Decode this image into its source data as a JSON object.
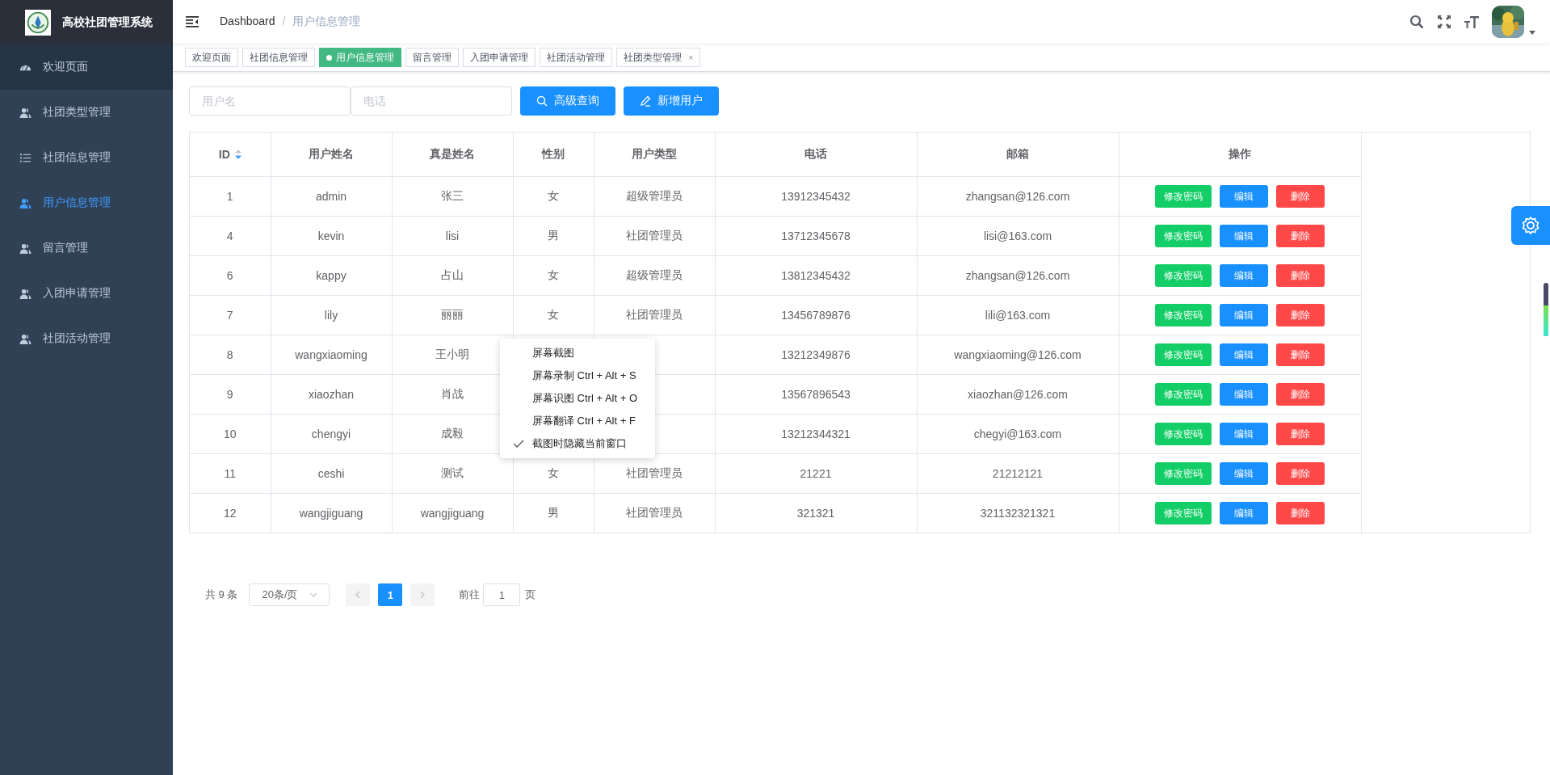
{
  "sidebar": {
    "title": "高校社团管理系统",
    "items": [
      {
        "label": "欢迎页面",
        "kind": "dashboard",
        "selected": false,
        "hovered": true
      },
      {
        "label": "社团类型管理",
        "kind": "user",
        "selected": false,
        "hovered": false
      },
      {
        "label": "社团信息管理",
        "kind": "list",
        "selected": false,
        "hovered": false
      },
      {
        "label": "用户信息管理",
        "kind": "user",
        "selected": true,
        "hovered": false
      },
      {
        "label": "留言管理",
        "kind": "user",
        "selected": false,
        "hovered": false
      },
      {
        "label": "入团申请管理",
        "kind": "user",
        "selected": false,
        "hovered": false
      },
      {
        "label": "社团活动管理",
        "kind": "user",
        "selected": false,
        "hovered": false
      }
    ]
  },
  "breadcrumb": [
    "Dashboard",
    "/",
    "用户信息管理"
  ],
  "tags": [
    {
      "label": "欢迎页面",
      "selected": false,
      "closable": false
    },
    {
      "label": "社团信息管理",
      "selected": false,
      "closable": false
    },
    {
      "label": "用户信息管理",
      "selected": true,
      "closable": false
    },
    {
      "label": "留言管理",
      "selected": false,
      "closable": false
    },
    {
      "label": "入团申请管理",
      "selected": false,
      "closable": false
    },
    {
      "label": "社团活动管理",
      "selected": false,
      "closable": false
    },
    {
      "label": "社团类型管理",
      "selected": false,
      "closable": true,
      "close": "×"
    }
  ],
  "search": {
    "username_placeholder": "用户名",
    "phone_placeholder": "电话",
    "query_button": "高级查询",
    "add_button": "新增用户"
  },
  "table": {
    "columns": [
      "ID",
      "用户姓名",
      "真是姓名",
      "性别",
      "用户类型",
      "电话",
      "邮箱",
      "操作"
    ],
    "rows": [
      {
        "id": "1",
        "username": "admin",
        "realname": "张三",
        "gender": "女",
        "type": "超级管理员",
        "phone": "13912345432",
        "email": "zhangsan@126.com"
      },
      {
        "id": "4",
        "username": "kevin",
        "realname": "lisi",
        "gender": "男",
        "type": "社团管理员",
        "phone": "13712345678",
        "email": "lisi@163.com"
      },
      {
        "id": "6",
        "username": "kappy",
        "realname": "占山",
        "gender": "女",
        "type": "超级管理员",
        "phone": "13812345432",
        "email": "zhangsan@126.com"
      },
      {
        "id": "7",
        "username": "lily",
        "realname": "丽丽",
        "gender": "女",
        "type": "社团管理员",
        "phone": "13456789876",
        "email": "lili@163.com"
      },
      {
        "id": "8",
        "username": "wangxiaoming",
        "realname": "王小明",
        "phone": "13212349876",
        "email": "wangxiaoming@126.com"
      },
      {
        "id": "9",
        "username": "xiaozhan",
        "realname": "肖战",
        "phone": "13567896543",
        "email": "xiaozhan@126.com"
      },
      {
        "id": "10",
        "username": "chengyi",
        "realname": "成毅",
        "phone": "13212344321",
        "email": "chegyi@163.com"
      },
      {
        "id": "11",
        "username": "ceshi",
        "realname": "测试",
        "gender": "女",
        "type": "社团管理员",
        "phone": "21221",
        "email": "21212121"
      },
      {
        "id": "12",
        "username": "wangjiguang",
        "realname": "wangjiguang",
        "gender": "男",
        "type": "社团管理员",
        "phone": "321321",
        "email": "321132321321"
      }
    ],
    "actions": [
      [
        {
          "label": "修改密码",
          "kind": "password"
        },
        {
          "label": "编辑",
          "kind": "edit"
        },
        {
          "label": "删除",
          "kind": "delete"
        }
      ],
      [
        {
          "label": "修改密码",
          "kind": "password"
        },
        {
          "label": "编辑",
          "kind": "edit"
        },
        {
          "label": "删除",
          "kind": "delete"
        }
      ],
      [
        {
          "label": "修改密码",
          "kind": "password"
        },
        {
          "label": "编辑",
          "kind": "edit"
        },
        {
          "label": "删除",
          "kind": "delete"
        }
      ],
      [
        {
          "label": "修改密码",
          "kind": "password"
        },
        {
          "label": "编辑",
          "kind": "edit"
        },
        {
          "label": "删除",
          "kind": "delete"
        }
      ],
      [
        {
          "label": "修改密码",
          "kind": "password"
        },
        {
          "label": "编辑",
          "kind": "edit"
        },
        {
          "label": "删除",
          "kind": "delete"
        }
      ],
      [
        {
          "label": "修改密码",
          "kind": "password"
        },
        {
          "label": "编辑",
          "kind": "edit"
        },
        {
          "label": "删除",
          "kind": "delete"
        }
      ],
      [
        {
          "label": "修改密码",
          "kind": "password"
        },
        {
          "label": "编辑",
          "kind": "edit"
        },
        {
          "label": "删除",
          "kind": "delete"
        }
      ],
      [
        {
          "label": "修改密码",
          "kind": "password"
        },
        {
          "label": "编辑",
          "kind": "edit"
        },
        {
          "label": "删除",
          "kind": "delete"
        }
      ],
      [
        {
          "label": "修改密码",
          "kind": "password"
        },
        {
          "label": "编辑",
          "kind": "edit"
        },
        {
          "label": "删除",
          "kind": "delete"
        }
      ]
    ]
  },
  "context_menu": {
    "items": [
      {
        "label": "屏幕截图",
        "checked": false
      },
      {
        "label": "屏幕录制 Ctrl + Alt + S",
        "checked": false
      },
      {
        "label": "屏幕识图 Ctrl + Alt + O",
        "checked": false
      },
      {
        "label": "屏幕翻译 Ctrl + Alt + F",
        "checked": false
      },
      {
        "label": "截图时隐藏当前窗口",
        "checked": true
      }
    ]
  },
  "pagination": {
    "total": "共 9 条",
    "page_size": "20条/页",
    "pages": [
      {
        "label": "1",
        "selected": true
      }
    ],
    "goto_label": "前往",
    "goto_value": "1",
    "page_unit": "页"
  }
}
